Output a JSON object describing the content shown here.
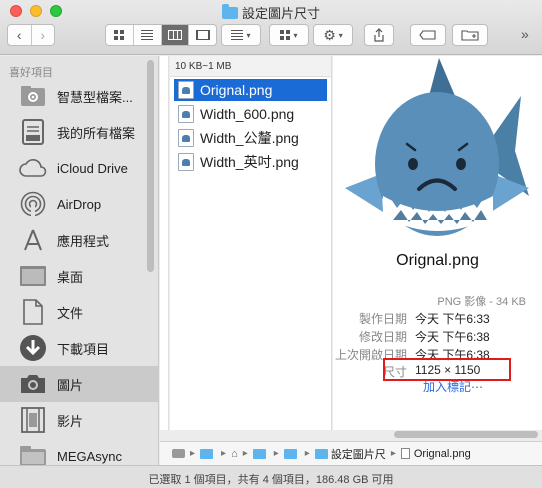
{
  "window": {
    "title": "設定圖片尺寸"
  },
  "toolbar": {
    "back_icon": "chevron-left-icon",
    "forward_icon": "chevron-right-icon",
    "view_modes": [
      "icon-view-icon",
      "list-view-icon",
      "column-view-icon",
      "coverflow-view-icon"
    ],
    "active_view": "column",
    "overflow": "»"
  },
  "sidebar": {
    "section": "喜好項目",
    "items": [
      {
        "label": "智慧型檔案...",
        "icon": "smart-folder-icon"
      },
      {
        "label": "我的所有檔案",
        "icon": "all-my-files-icon"
      },
      {
        "label": "iCloud Drive",
        "icon": "cloud-icon"
      },
      {
        "label": "AirDrop",
        "icon": "airdrop-icon"
      },
      {
        "label": "應用程式",
        "icon": "applications-icon"
      },
      {
        "label": "桌面",
        "icon": "desktop-icon"
      },
      {
        "label": "文件",
        "icon": "document-icon"
      },
      {
        "label": "下載項目",
        "icon": "download-icon"
      },
      {
        "label": "圖片",
        "icon": "camera-icon"
      },
      {
        "label": "影片",
        "icon": "film-icon"
      },
      {
        "label": "MEGAsync",
        "icon": "folder-icon"
      }
    ]
  },
  "browser": {
    "group_header": "10 KB~1 MB",
    "files": [
      "Orignal.png",
      "Width_600.png",
      "Width_公釐.png",
      "Width_英吋.png"
    ]
  },
  "preview": {
    "name": "Orignal.png",
    "kind": "PNG 影像 - 34 KB",
    "meta": [
      {
        "key": "製作日期",
        "value": "今天 下午6:33"
      },
      {
        "key": "修改日期",
        "value": "今天 下午6:38"
      },
      {
        "key": "上次開啟日期",
        "value": "今天 下午6:38"
      },
      {
        "key": "尺寸",
        "value": "1125 × 1150"
      }
    ],
    "add_tags": "加入標記⋯"
  },
  "pathbar": {
    "crumbs": [
      "設定圖片尺",
      "Orignal.png"
    ]
  },
  "status": {
    "text": "已選取 1 個項目，共有 4 個項目，186.48 GB 可用"
  },
  "colors": {
    "selection": "#1b6bd6",
    "highlight_box": "#e01b1b",
    "folder": "#5eb4ec"
  }
}
